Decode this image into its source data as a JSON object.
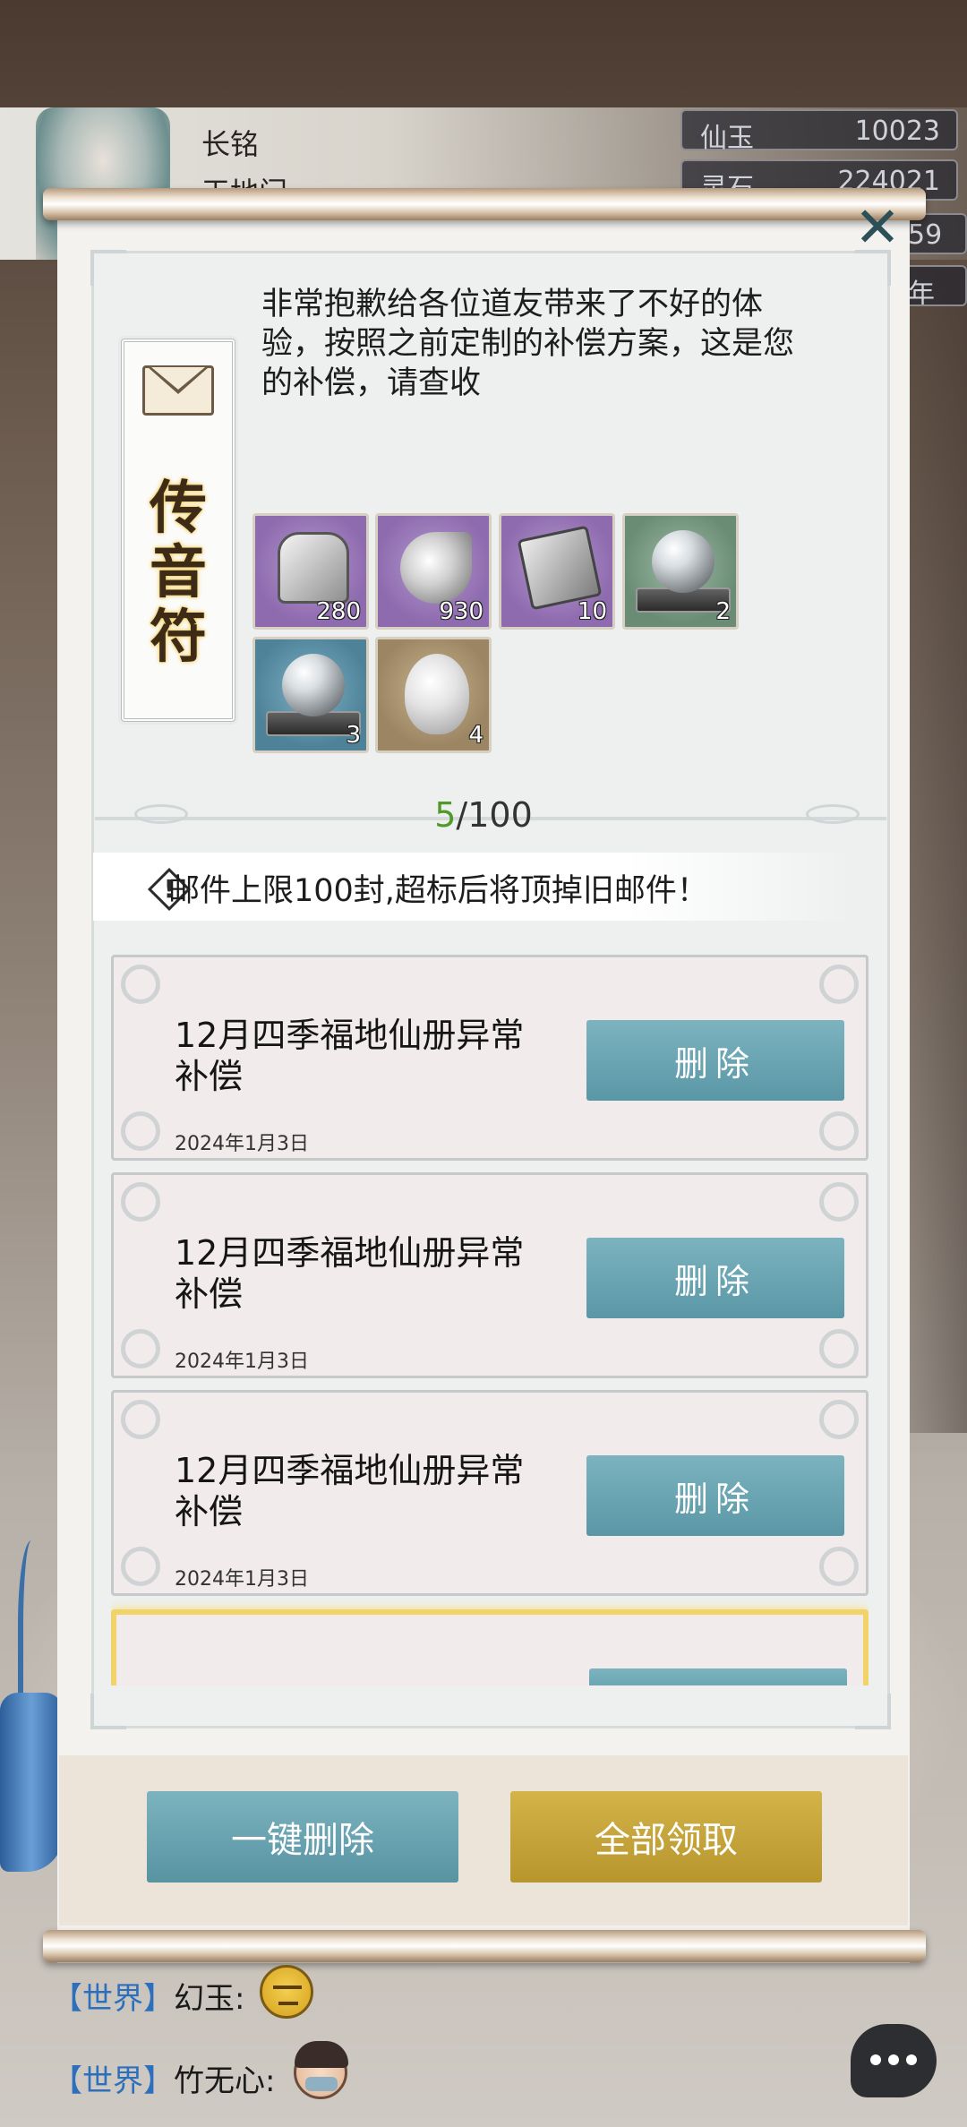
{
  "player": {
    "name": "长铭",
    "sect": "天地门"
  },
  "resources": [
    {
      "label": "仙玉",
      "value": "10023"
    },
    {
      "label": "灵石",
      "value": "224021"
    },
    {
      "label": "",
      "value": "59"
    },
    {
      "label": "",
      "value": "年"
    }
  ],
  "mail_detail": {
    "card_title": "传音符",
    "message": "非常抱歉给各位道友带来了不好的体验，按照之前定制的补偿方案，这是您的补偿，请查收",
    "attachments": [
      {
        "icon": "token-tablet-icon",
        "count": "280",
        "rarity": "purple"
      },
      {
        "icon": "spirit-swirl-icon",
        "count": "930",
        "rarity": "purple"
      },
      {
        "icon": "scroll-book-icon",
        "count": "10",
        "rarity": "purple"
      },
      {
        "icon": "crystal-orb-icon",
        "count": "2",
        "rarity": "green"
      },
      {
        "icon": "crystal-orb-icon",
        "count": "3",
        "rarity": "blue"
      },
      {
        "icon": "spirit-egg-icon",
        "count": "4",
        "rarity": "tan"
      }
    ]
  },
  "mailbox": {
    "current": "5",
    "limit": "/100",
    "notice": "邮件上限100封,超标后将顶掉旧邮件！",
    "mails": [
      {
        "subject": "12月四季福地仙册异常补偿",
        "date": "2024年1月3日",
        "delete_label": "删除"
      },
      {
        "subject": "12月四季福地仙册异常补偿",
        "date": "2024年1月3日",
        "delete_label": "删除"
      },
      {
        "subject": "12月四季福地仙册异常补偿",
        "date": "2024年1月3日",
        "delete_label": "删除"
      }
    ],
    "delete_all_label": "一键删除",
    "claim_all_label": "全部领取"
  },
  "chat": [
    {
      "channel": "【世界】",
      "user": "幻玉:"
    },
    {
      "channel": "【世界】",
      "user": "竹无心:"
    }
  ],
  "colors": {
    "teal_button": "#6aa6b4",
    "gold_button": "#c6a63a",
    "counter_green": "#4f9a2a",
    "world_channel": "#2c6fbd"
  }
}
